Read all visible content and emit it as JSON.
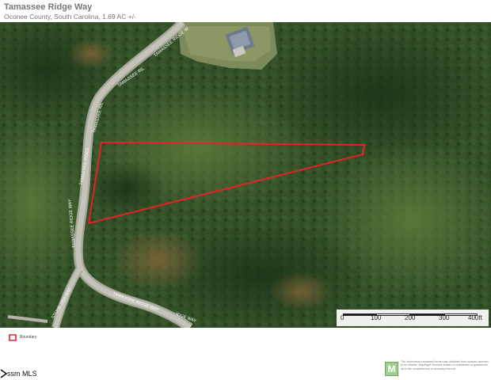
{
  "header": {
    "title": "Tamassee Ridge Way",
    "subtitle": "Oconee County, South Carolina, 1.69 AC +/-"
  },
  "map": {
    "road_labels": [
      "TAMASSEE RIDGE W",
      "TAMASSEE RIL",
      "TAMASSEE RIL",
      "TAMASSEE RIDGE",
      "TAMASSEE RIDGE WAY",
      "TAMASSEE RIDGE WAY",
      "IDGE WAY",
      "STONE SEA WAY"
    ],
    "boundary_color": "#e8202a",
    "scale": {
      "ticks": [
        "0",
        "100",
        "200",
        "300",
        "400ft"
      ]
    }
  },
  "legend": {
    "label": "Boundary",
    "icon": "boundary-icon"
  },
  "footer": {
    "corner_text": "ssm MLS",
    "badge_letter": "M",
    "disclaimer": "The information contained herein was obtained from sources deemed to be reliable. MapRight Services makes no warranties or guarantees as to the completeness or accuracy thereof."
  }
}
